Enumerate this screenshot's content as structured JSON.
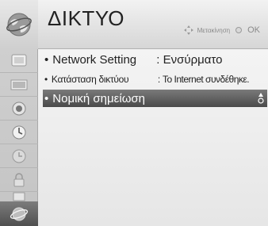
{
  "menu": {
    "title": "ΔΙΚΤΥΟ",
    "hint_move": "Μετακίνηση",
    "hint_ok": "OK"
  },
  "sidebar": {
    "items": [
      {
        "icon": "tv-picture-icon"
      },
      {
        "icon": "audio-icon"
      },
      {
        "icon": "screen-icon"
      },
      {
        "icon": "option-icon"
      },
      {
        "icon": "clock-icon"
      },
      {
        "icon": "lock-icon"
      },
      {
        "icon": "input-icon"
      },
      {
        "icon": "network-icon",
        "active": true
      }
    ]
  },
  "items": [
    {
      "bullet": "•",
      "label": "Network Setting",
      "sep": ":",
      "value": "Ενσύρματο"
    },
    {
      "bullet": "•",
      "label": "Κατάσταση δικτύου",
      "sep": ":",
      "value": "Το Internet συνδέθηκε."
    },
    {
      "bullet": "•",
      "label": "Νομική σημείωση",
      "selected": true
    }
  ],
  "colors": {
    "highlight": "#5e5e5e",
    "text": "#222222",
    "hint": "#8a8a8a"
  }
}
